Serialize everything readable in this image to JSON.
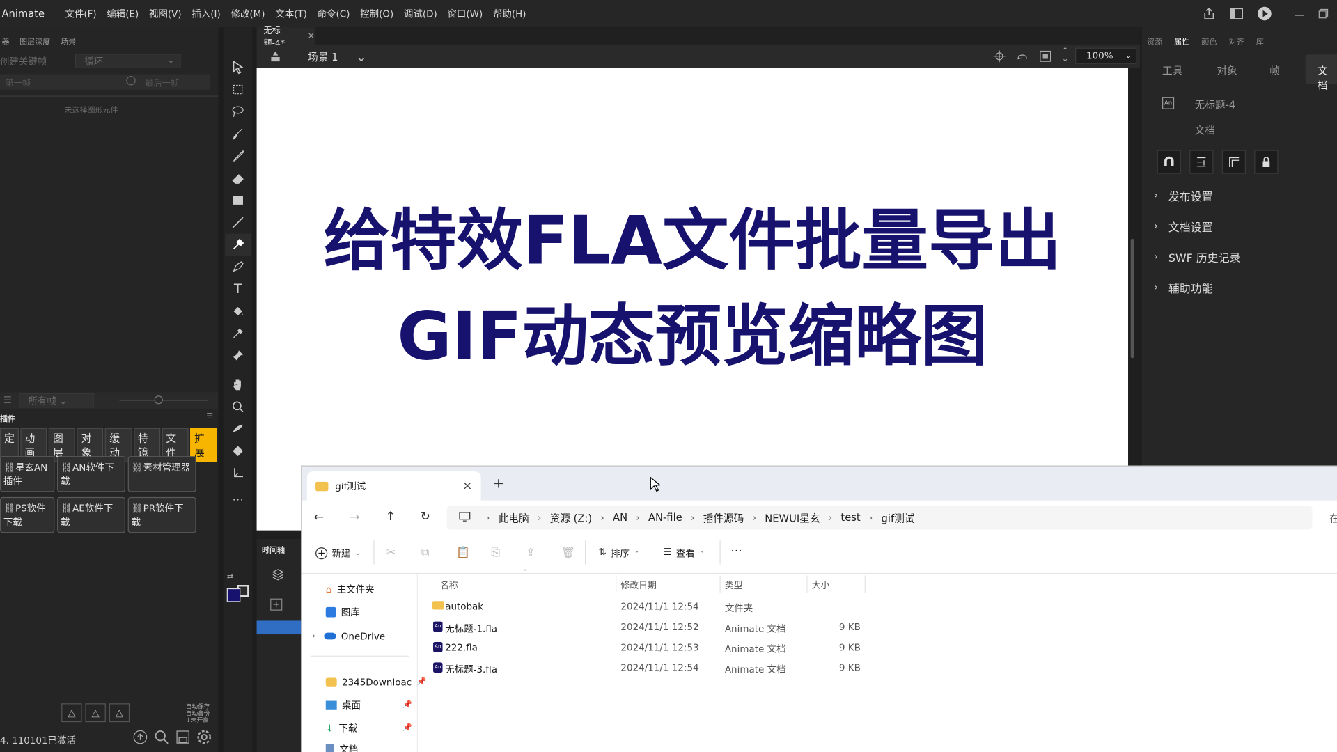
{
  "app": {
    "name": "Animate"
  },
  "menu": [
    "文件(F)",
    "编辑(E)",
    "视图(V)",
    "插入(I)",
    "修改(M)",
    "文本(T)",
    "命令(C)",
    "控制(O)",
    "调试(D)",
    "窗口(W)",
    "帮助(H)"
  ],
  "left_panel": {
    "tabs": [
      "器",
      "图层深度",
      "场景"
    ],
    "keyframe_label": "创建关键帧",
    "loop_select": "循环",
    "first_frame": "第一帧",
    "last_frame": "最后一帧",
    "no_selection": "未选择图形元件",
    "all_frames": "所有帧",
    "plugin_title": "插件",
    "plugin_tabs": [
      "定",
      "动画",
      "图层",
      "对象",
      "缓动",
      "特镜",
      "文件",
      "扩展"
    ],
    "plugin_buttons": [
      "星玄AN插件",
      "AN软件下载",
      "素材管理器",
      "PS软件下载",
      "AE软件下载",
      "PR软件下载"
    ],
    "autosave": "自动保存\n自动备份\n↓未开启",
    "status": "4. 110101已激活"
  },
  "document": {
    "tab": "无标题-4*",
    "scene": "场景 1",
    "zoom": "100%",
    "title_line1": "给特效FLA文件批量导出",
    "title_line2": "GIF动态预览缩略图",
    "timeline_label": "时间轴"
  },
  "right_panel": {
    "top_tabs": [
      "资源",
      "属性",
      "颜色",
      "对齐",
      "库"
    ],
    "tabs": [
      "工具",
      "对象",
      "帧",
      "文档"
    ],
    "doc_name": "无标题-4",
    "doc_type": "文档",
    "sections": [
      "发布设置",
      "文档设置",
      "SWF 历史记录",
      "辅助功能"
    ]
  },
  "explorer": {
    "tab_title": "gif测试",
    "breadcrumbs": [
      "此电脑",
      "资源 (Z:)",
      "AN",
      "AN-file",
      "插件源码",
      "NEWUI星玄",
      "test",
      "gif测试"
    ],
    "search_stub": "在",
    "commands": {
      "new": "新建",
      "sort": "排序",
      "view": "查看"
    },
    "nav": [
      {
        "label": "主文件夹",
        "icon": "home-icon"
      },
      {
        "label": "图库",
        "icon": "gallery-icon"
      },
      {
        "label": "OneDrive",
        "icon": "cloud-icon"
      },
      {
        "label": "2345Downloac",
        "icon": "folder-icon"
      },
      {
        "label": "桌面",
        "icon": "desktop-icon"
      },
      {
        "label": "下载",
        "icon": "download-icon"
      },
      {
        "label": "文档",
        "icon": "document-icon"
      }
    ],
    "columns": {
      "name": "名称",
      "date": "修改日期",
      "type": "类型",
      "size": "大小"
    },
    "files": [
      {
        "name": "autobak",
        "date": "2024/11/1 12:54",
        "type": "文件夹",
        "size": "",
        "kind": "folder"
      },
      {
        "name": "无标题-1.fla",
        "date": "2024/11/1 12:52",
        "type": "Animate 文档",
        "size": "9 KB",
        "kind": "fla"
      },
      {
        "name": "222.fla",
        "date": "2024/11/1 12:53",
        "type": "Animate 文档",
        "size": "9 KB",
        "kind": "fla"
      },
      {
        "name": "无标题-3.fla",
        "date": "2024/11/1 12:54",
        "type": "Animate 文档",
        "size": "9 KB",
        "kind": "fla"
      }
    ]
  },
  "colors": {
    "title": "#16126e",
    "accent": "#f7b500",
    "stage": "#ffffff"
  }
}
